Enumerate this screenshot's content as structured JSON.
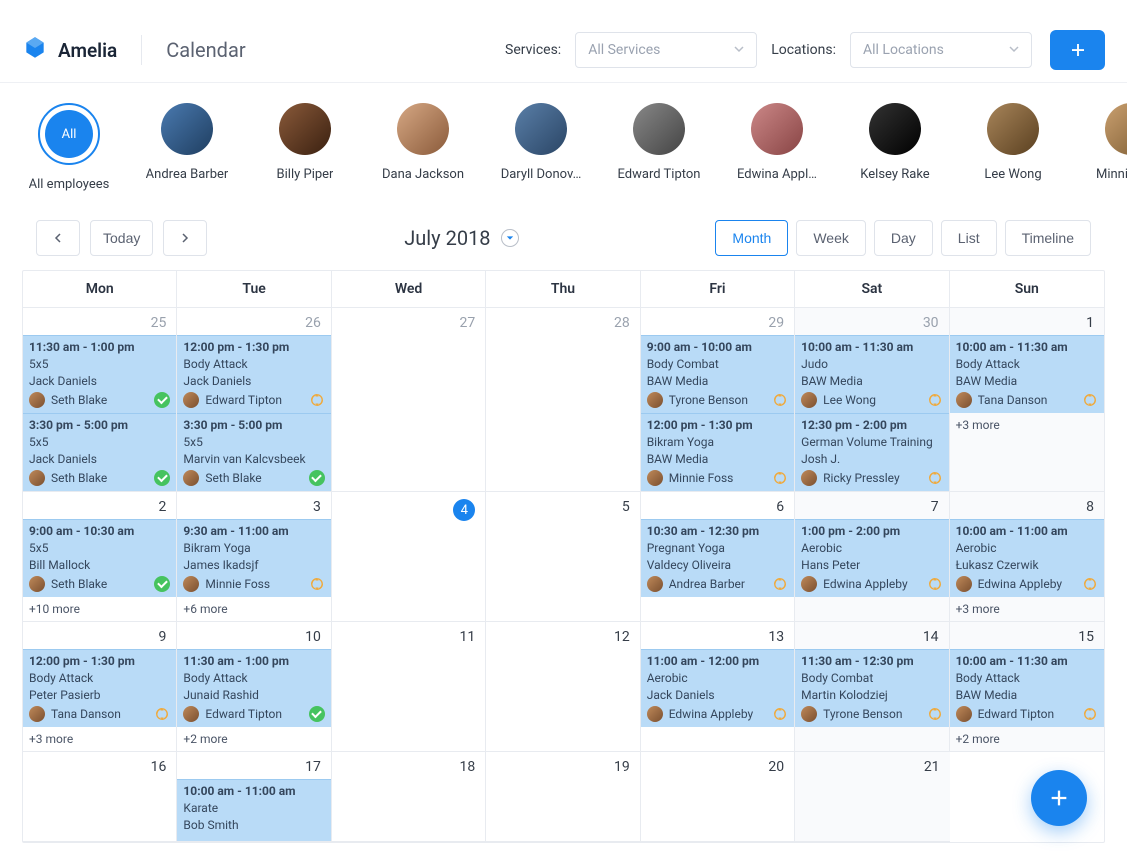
{
  "brand": "Amelia",
  "page_title": "Calendar",
  "filters": {
    "services_label": "Services:",
    "services_placeholder": "All Services",
    "locations_label": "Locations:",
    "locations_placeholder": "All Locations"
  },
  "employees": [
    {
      "name": "All employees",
      "all": true,
      "badge": "All"
    },
    {
      "name": "Andrea Barber"
    },
    {
      "name": "Billy Piper"
    },
    {
      "name": "Dana Jackson"
    },
    {
      "name": "Daryll Donov…"
    },
    {
      "name": "Edward Tipton"
    },
    {
      "name": "Edwina Appl…"
    },
    {
      "name": "Kelsey Rake"
    },
    {
      "name": "Lee Wong"
    },
    {
      "name": "Minnie Foss"
    },
    {
      "name": "Ricky Pressley"
    },
    {
      "name": "Seth Blak"
    }
  ],
  "toolbar": {
    "today": "Today",
    "date": "July 2018",
    "views": [
      "Month",
      "Week",
      "Day",
      "List",
      "Timeline"
    ],
    "active_view": 0
  },
  "weekdays": [
    "Mon",
    "Tue",
    "Wed",
    "Thu",
    "Fri",
    "Sat",
    "Sun"
  ],
  "weeks": [
    {
      "days": [
        {
          "num": 25,
          "out": true,
          "events": [
            {
              "time": "11:30 am - 1:00 pm",
              "service": "5x5",
              "customer": "Jack Daniels",
              "employee": "Seth Blake",
              "status": "approved"
            },
            {
              "time": "3:30 pm - 5:00 pm",
              "service": "5x5",
              "customer": "Jack Daniels",
              "employee": "Seth Blake",
              "status": "approved"
            }
          ]
        },
        {
          "num": 26,
          "out": true,
          "events": [
            {
              "time": "12:00 pm - 1:30 pm",
              "service": "Body Attack",
              "customer": "Jack Daniels",
              "employee": "Edward Tipton",
              "status": "pending"
            },
            {
              "time": "3:30 pm - 5:00 pm",
              "service": "5x5",
              "customer": "Marvin van Kalcvsbeek",
              "employee": "Seth Blake",
              "status": "approved"
            }
          ]
        },
        {
          "num": 27,
          "out": true,
          "events": []
        },
        {
          "num": 28,
          "out": true,
          "events": []
        },
        {
          "num": 29,
          "out": true,
          "events": [
            {
              "time": "9:00 am - 10:00 am",
              "service": "Body Combat",
              "customer": "BAW Media",
              "employee": "Tyrone Benson",
              "status": "pending"
            },
            {
              "time": "12:00 pm - 1:30 pm",
              "service": "Bikram Yoga",
              "customer": "BAW Media",
              "employee": "Minnie Foss",
              "status": "pending"
            }
          ]
        },
        {
          "num": 30,
          "out": true,
          "weekend": true,
          "events": [
            {
              "time": "10:00 am - 11:30 am",
              "service": "Judo",
              "customer": "BAW Media",
              "employee": "Lee Wong",
              "status": "pending"
            },
            {
              "time": "12:30 pm - 2:00 pm",
              "service": "German Volume Training",
              "customer": "Josh J.",
              "employee": "Ricky Pressley",
              "status": "pending"
            }
          ]
        },
        {
          "num": 1,
          "weekend": true,
          "events": [
            {
              "time": "10:00 am - 11:30 am",
              "service": "Body Attack",
              "customer": "BAW Media",
              "employee": "Tana Danson",
              "status": "pending"
            }
          ],
          "more": "+3 more"
        }
      ]
    },
    {
      "days": [
        {
          "num": 2,
          "events": [
            {
              "time": "9:00 am - 10:30 am",
              "service": "5x5",
              "customer": "Bill Mallock",
              "employee": "Seth Blake",
              "status": "approved"
            }
          ],
          "more": "+10 more"
        },
        {
          "num": 3,
          "events": [
            {
              "time": "9:30 am - 11:00 am",
              "service": "Bikram Yoga",
              "customer": "James Ikadsjf",
              "employee": "Minnie Foss",
              "status": "pending"
            }
          ],
          "more": "+6 more"
        },
        {
          "num": 4,
          "today": true,
          "events": []
        },
        {
          "num": 5,
          "events": []
        },
        {
          "num": 6,
          "events": [
            {
              "time": "10:30 am - 12:30 pm",
              "service": "Pregnant Yoga",
              "customer": "Valdecy Oliveira",
              "employee": "Andrea Barber",
              "status": "pending"
            }
          ]
        },
        {
          "num": 7,
          "weekend": true,
          "events": [
            {
              "time": "1:00 pm - 2:00 pm",
              "service": "Aerobic",
              "customer": "Hans Peter",
              "employee": "Edwina Appleby",
              "status": "pending"
            }
          ]
        },
        {
          "num": 8,
          "weekend": true,
          "events": [
            {
              "time": "10:00 am - 11:00 am",
              "service": "Aerobic",
              "customer": "Łukasz Czerwik",
              "employee": "Edwina Appleby",
              "status": "pending"
            }
          ],
          "more": "+3 more"
        }
      ]
    },
    {
      "days": [
        {
          "num": 9,
          "events": [
            {
              "time": "12:00 pm - 1:30 pm",
              "service": "Body Attack",
              "customer": "Peter Pasierb",
              "employee": "Tana Danson",
              "status": "pending"
            }
          ],
          "more": "+3 more"
        },
        {
          "num": 10,
          "events": [
            {
              "time": "11:30 am - 1:00 pm",
              "service": "Body Attack",
              "customer": "Junaid Rashid",
              "employee": "Edward Tipton",
              "status": "approved"
            }
          ],
          "more": "+2 more"
        },
        {
          "num": 11,
          "events": []
        },
        {
          "num": 12,
          "events": []
        },
        {
          "num": 13,
          "events": [
            {
              "time": "11:00 am - 12:00 pm",
              "service": "Aerobic",
              "customer": "Jack Daniels",
              "employee": "Edwina Appleby",
              "status": "pending"
            }
          ]
        },
        {
          "num": 14,
          "weekend": true,
          "events": [
            {
              "time": "11:30 am - 12:30 pm",
              "service": "Body Combat",
              "customer": "Martin Kolodziej",
              "employee": "Tyrone Benson",
              "status": "pending"
            }
          ]
        },
        {
          "num": 15,
          "weekend": true,
          "events": [
            {
              "time": "10:00 am - 11:30 am",
              "service": "Body Attack",
              "customer": "BAW Media",
              "employee": "Edward Tipton",
              "status": "pending"
            }
          ],
          "more": "+2 more"
        }
      ]
    },
    {
      "days": [
        {
          "num": 16,
          "events": []
        },
        {
          "num": 17,
          "events": [
            {
              "time": "10:00 am - 11:00 am",
              "service": "Karate",
              "customer": "Bob Smith"
            }
          ]
        },
        {
          "num": 18,
          "events": []
        },
        {
          "num": 19,
          "events": []
        },
        {
          "num": 20,
          "events": []
        },
        {
          "num": 21,
          "weekend": true,
          "events": []
        }
      ]
    }
  ],
  "avatar_gradients": [
    "linear-gradient(135deg,#4a7ab0,#1f3e60)",
    "linear-gradient(135deg,#8a5a3a,#3a2010)",
    "linear-gradient(135deg,#d6a884,#8a5a3a)",
    "linear-gradient(135deg,#5a7fa8,#2a4565)",
    "linear-gradient(135deg,#888,#444)",
    "linear-gradient(135deg,#c88,#844)",
    "linear-gradient(135deg,#333,#000)",
    "linear-gradient(135deg,#a8855a,#5a4020)",
    "linear-gradient(135deg,#caa070,#7a5a30)",
    "linear-gradient(135deg,#555,#222)",
    "linear-gradient(135deg,#7a6040,#3a2a10)"
  ]
}
